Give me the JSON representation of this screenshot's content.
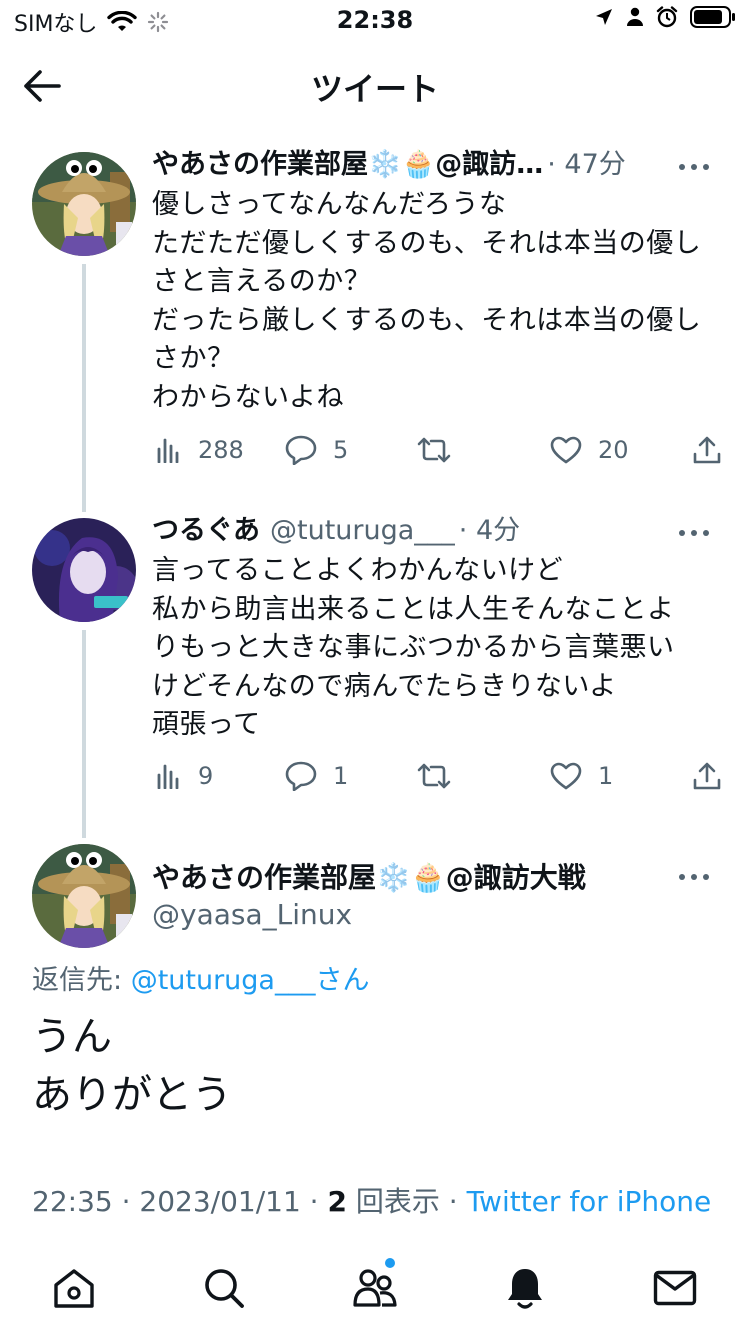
{
  "status_bar": {
    "carrier": "SIMなし",
    "time": "22:38"
  },
  "header": {
    "title": "ツイート"
  },
  "tweets": [
    {
      "name": "やあさの作業部屋❄️🧁@諏訪…",
      "handle": "",
      "time": "· 47分",
      "lines": [
        "優しさってなんなんだろうな",
        "ただただ優しくするのも、それは本当の優し",
        "さと言えるのか？",
        "だったら厳しくするのも、それは本当の優し",
        "さか？",
        "わからないよね"
      ],
      "views": "288",
      "replies": "5",
      "retweets": "",
      "likes": "20"
    },
    {
      "name": "つるぐあ",
      "handle": "@tuturuga___",
      "time": "· 4分",
      "lines": [
        "言ってることよくわかんないけど",
        "私から助言出来ることは人生そんなことよ",
        "りもっと大きな事にぶつかるから言葉悪い",
        "けどそんなので病んでたらきりないよ",
        "頑張って"
      ],
      "views": "9",
      "replies": "1",
      "retweets": "",
      "likes": "1"
    }
  ],
  "focused_tweet": {
    "name": "やあさの作業部屋❄️🧁@諏訪大戦",
    "handle": "@yaasa_Linux",
    "reply_prefix": "返信先: ",
    "reply_link": "@tuturuga___",
    "reply_suffix": "さん",
    "lines": [
      "うん",
      "ありがとう"
    ],
    "timestamp": "22:35 · 2023/01/11 · ",
    "view_count": "2",
    "view_suffix": " 回表示 · ",
    "source": "Twitter for iPhone"
  },
  "colors": {
    "accent": "#1d9bf0",
    "secondary_text": "#536471",
    "thread_line": "#cfd9de"
  }
}
